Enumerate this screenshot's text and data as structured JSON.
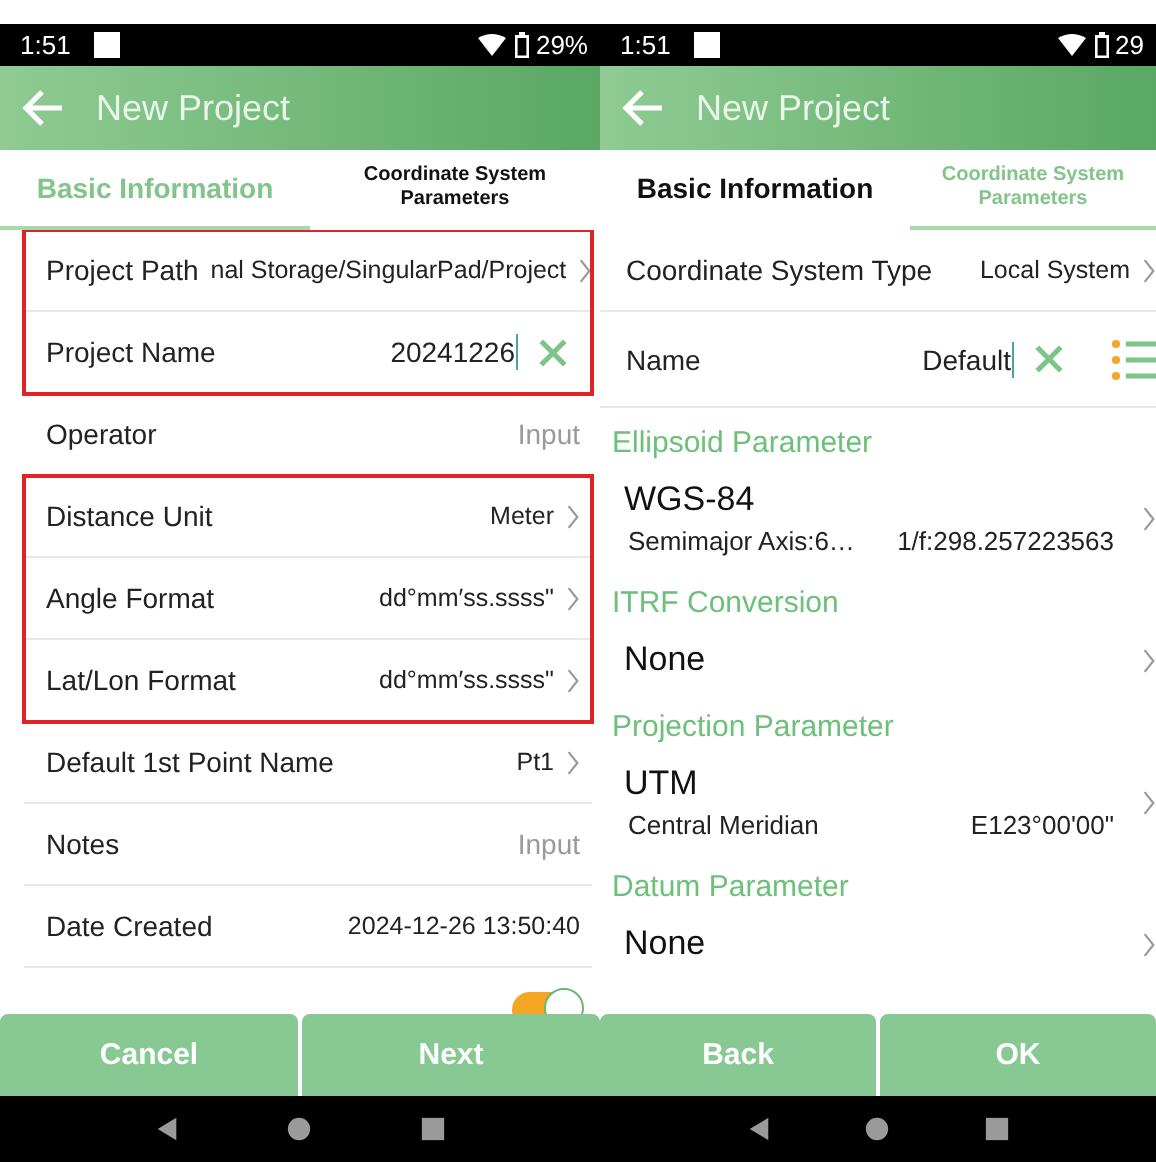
{
  "screens": [
    {
      "status": {
        "time": "1:51",
        "battery": "29%"
      },
      "title": "New Project",
      "tabs": [
        {
          "label": "Basic Information",
          "selected": true
        },
        {
          "label": "Coordinate System Parameters",
          "selected": false
        }
      ],
      "groups": [
        {
          "outlined": true,
          "items": [
            {
              "kind": "row",
              "label": "Project Path",
              "value": "nal Storage/SingularPad/Project",
              "chevron": true
            },
            {
              "kind": "edit",
              "label": "Project Name",
              "value": "20241226",
              "list_button": false
            }
          ]
        },
        {
          "outlined": false,
          "items": [
            {
              "kind": "input",
              "label": "Operator",
              "placeholder": "Input"
            }
          ]
        },
        {
          "outlined": true,
          "items": [
            {
              "kind": "row",
              "label": "Distance Unit",
              "value": "Meter",
              "chevron": true
            },
            {
              "kind": "row",
              "label": "Angle Format",
              "value": "dd°mm′ss.ssss\"",
              "chevron": true
            },
            {
              "kind": "row",
              "label": "Lat/Lon Format",
              "value": "dd°mm′ss.ssss\"",
              "chevron": true
            }
          ]
        },
        {
          "outlined": false,
          "items": [
            {
              "kind": "row",
              "label": "Default 1st Point Name",
              "value": "Pt1",
              "chevron": true
            },
            {
              "kind": "input",
              "label": "Notes",
              "placeholder": "Input"
            },
            {
              "kind": "row",
              "label": "Date Created",
              "value": "2024-12-26 13:50:40",
              "chevron": false
            },
            {
              "kind": "toggle",
              "on": true
            }
          ]
        }
      ],
      "buttons": [
        "Cancel",
        "Next"
      ]
    },
    {
      "status": {
        "time": "1:51",
        "battery": "29"
      },
      "title": "New Project",
      "tabs": [
        {
          "label": "Basic Information",
          "selected": false
        },
        {
          "label": "Coordinate System Parameters",
          "selected": true
        }
      ],
      "groups": [
        {
          "outlined": false,
          "items": [
            {
              "kind": "row",
              "label": "Coordinate System Type",
              "value": "Local System",
              "chevron": true
            },
            {
              "kind": "edit",
              "label": "Name",
              "value": "Default",
              "list_button": true
            },
            {
              "kind": "header",
              "label": "Ellipsoid Parameter"
            },
            {
              "kind": "item",
              "title": "WGS-84",
              "sub": [
                "Semimajor Axis:6…",
                "1/f:298.257223563"
              ]
            },
            {
              "kind": "header",
              "label": "ITRF Conversion"
            },
            {
              "kind": "item",
              "title": "None"
            },
            {
              "kind": "header",
              "label": "Projection Parameter"
            },
            {
              "kind": "item",
              "title": "UTM",
              "sub": [
                "Central Meridian",
                "E123°00'00\""
              ]
            },
            {
              "kind": "header",
              "label": "Datum Parameter"
            },
            {
              "kind": "item",
              "title": "None"
            }
          ]
        }
      ],
      "buttons": [
        "Back",
        "OK"
      ]
    }
  ]
}
